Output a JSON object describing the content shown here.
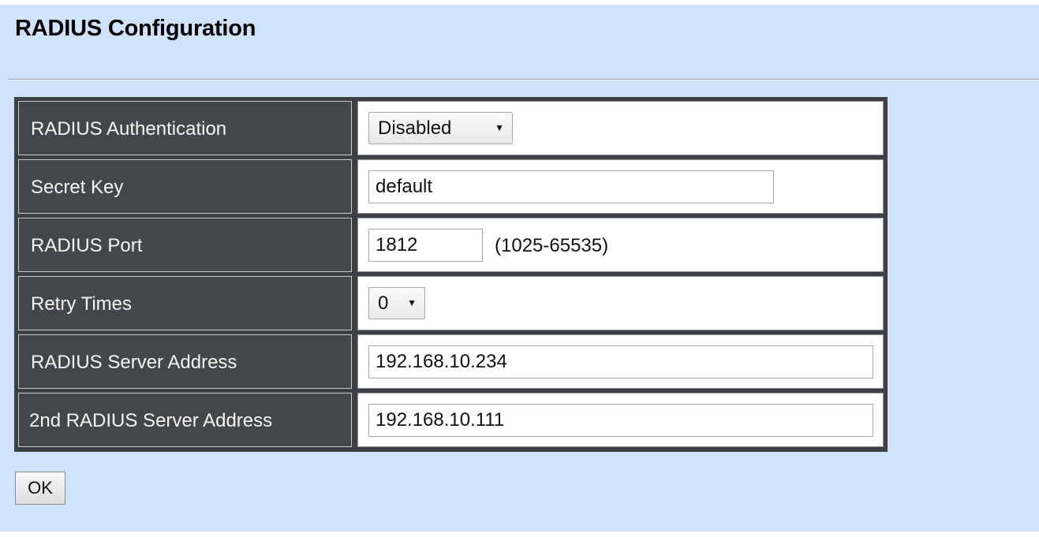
{
  "page": {
    "title": "RADIUS Configuration"
  },
  "form": {
    "rows": [
      {
        "label": "RADIUS Authentication",
        "control": "select",
        "value": "Disabled"
      },
      {
        "label": "Secret Key",
        "control": "text",
        "value": "default"
      },
      {
        "label": "RADIUS Port",
        "control": "text",
        "value": "1812",
        "hint": "(1025-65535)"
      },
      {
        "label": "Retry Times",
        "control": "select",
        "value": "0"
      },
      {
        "label": "RADIUS Server Address",
        "control": "text",
        "value": "192.168.10.234"
      },
      {
        "label": "2nd RADIUS Server Address",
        "control": "text",
        "value": "192.168.10.111"
      }
    ]
  },
  "actions": {
    "ok_label": "OK"
  },
  "icons": {
    "dropdown": "caret-down-icon"
  },
  "colors": {
    "background": "#cfe3fc",
    "label_cell": "#444749",
    "table_border": "#3c3f43",
    "value_cell": "#ffffff"
  }
}
